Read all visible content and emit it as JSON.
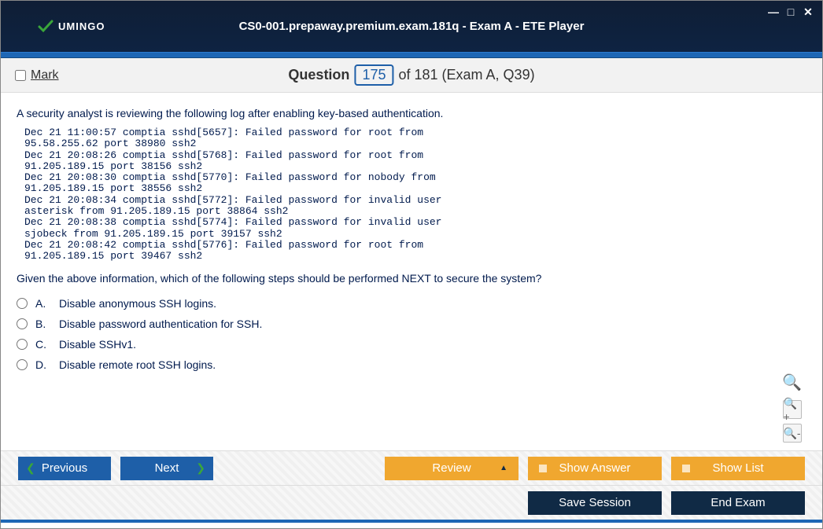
{
  "window": {
    "title": "CS0-001.prepaway.premium.exam.181q - Exam A - ETE Player",
    "logo_text": "UMINGO"
  },
  "header": {
    "mark_label": "Mark",
    "question_label": "Question",
    "current_number": "175",
    "of_text": "of 181 (Exam A, Q39)"
  },
  "question": {
    "intro": "A security analyst is reviewing the following log after enabling key-based authentication.",
    "log": "Dec 21 11:00:57 comptia sshd[5657]: Failed password for root from\n95.58.255.62 port 38980 ssh2\nDec 21 20:08:26 comptia sshd[5768]: Failed password for root from\n91.205.189.15 port 38156 ssh2\nDec 21 20:08:30 comptia sshd[5770]: Failed password for nobody from\n91.205.189.15 port 38556 ssh2\nDec 21 20:08:34 comptia sshd[5772]: Failed password for invalid user\nasterisk from 91.205.189.15 port 38864 ssh2\nDec 21 20:08:38 comptia sshd[5774]: Failed password for invalid user\nsjobeck from 91.205.189.15 port 39157 ssh2\nDec 21 20:08:42 comptia sshd[5776]: Failed password for root from\n91.205.189.15 port 39467 ssh2",
    "prompt": "Given the above information, which of the following steps should be performed NEXT to secure the system?",
    "options": [
      {
        "letter": "A.",
        "text": "Disable anonymous SSH logins."
      },
      {
        "letter": "B.",
        "text": "Disable password authentication for SSH."
      },
      {
        "letter": "C.",
        "text": "Disable SSHv1."
      },
      {
        "letter": "D.",
        "text": "Disable remote root SSH logins."
      }
    ]
  },
  "footer": {
    "previous": "Previous",
    "next": "Next",
    "review": "Review",
    "show_answer": "Show Answer",
    "show_list": "Show List",
    "save_session": "Save Session",
    "end_exam": "End Exam"
  }
}
